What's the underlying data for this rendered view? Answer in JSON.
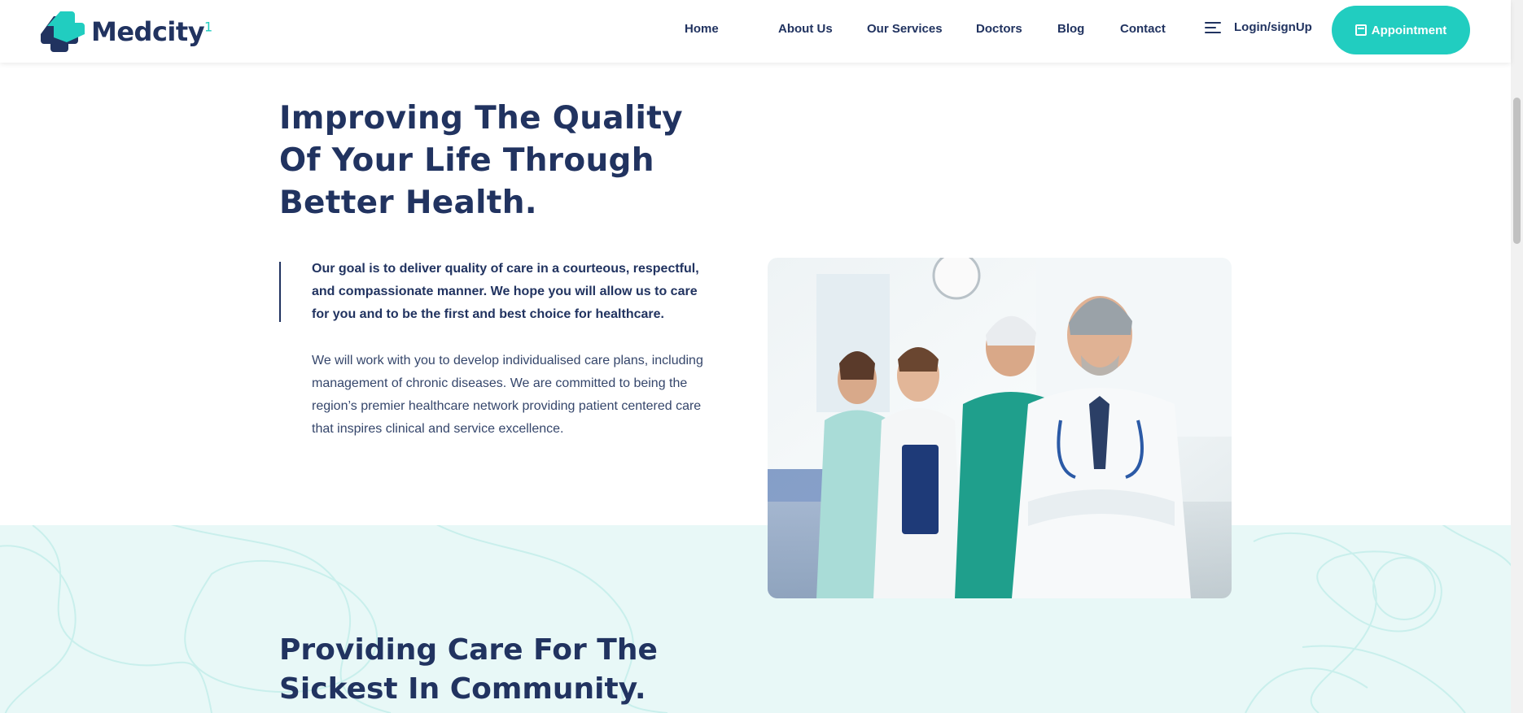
{
  "brand": {
    "name": "Medcity",
    "superscript": "1",
    "accent_color": "#21cdc0",
    "primary_color": "#213360"
  },
  "nav": {
    "items": [
      {
        "label": "Home"
      },
      {
        "label": "About Us"
      },
      {
        "label": "Our Services"
      },
      {
        "label": "Doctors"
      },
      {
        "label": "Blog"
      },
      {
        "label": "Contact"
      }
    ],
    "login_label": "Login/signUp",
    "login_icon": "hamburger-menu-icon",
    "appointment_label": "Appointment",
    "appointment_icon": "calendar-icon"
  },
  "hero": {
    "title": "Improving The Quality Of Your Life Through Better Health.",
    "quote": "Our goal is to deliver quality of care in a courteous, respectful, and compassionate manner. We hope you will allow us to care for you and to be the first and best choice for healthcare.",
    "body": "We will work with you to develop individualised care plans, including management of chronic diseases. We are committed to being the region’s premier healthcare network providing patient centered care that inspires clinical and service excellence."
  },
  "section2": {
    "title": "Providing Care For The Sickest In Community."
  }
}
